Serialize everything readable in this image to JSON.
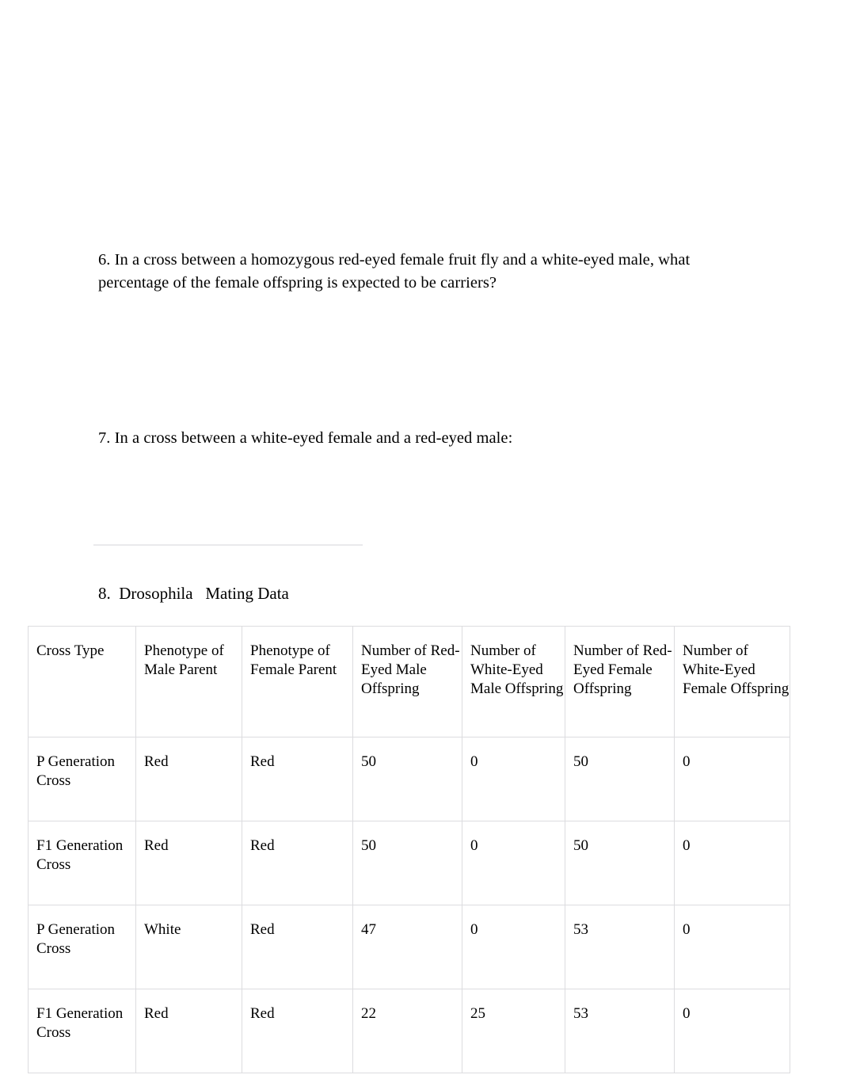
{
  "questions": [
    {
      "id": "q6",
      "text": "6. In a cross between a homozygous red-eyed female fruit fly and a white-eyed male, what percentage of the female offspring is expected to be carriers?"
    },
    {
      "id": "q7",
      "text": "7. In a cross between a white-eyed female and a red-eyed male:"
    }
  ],
  "table_section": {
    "caption": "8.  Drosophila   Mating Data",
    "headers": [
      "Cross Type",
      "Phenotype of Male Parent",
      "Phenotype of Female Parent",
      "Number of Red-Eyed Male Offspring",
      "Number of White-Eyed Male Offspring",
      "Number of Red-Eyed Female Offspring",
      "Number of White-Eyed Female Offspring"
    ],
    "rows": [
      {
        "cross_type": "P Generation Cross",
        "male_parent_phenotype": "Red",
        "female_parent_phenotype": "Red",
        "red_eyed_male_offspring": "50",
        "white_eyed_male_offspring": "0",
        "red_eyed_female_offspring": "50",
        "white_eyed_female_offspring": "0"
      },
      {
        "cross_type": "F1 Generation Cross",
        "male_parent_phenotype": "Red",
        "female_parent_phenotype": "Red",
        "red_eyed_male_offspring": "50",
        "white_eyed_male_offspring": "0",
        "red_eyed_female_offspring": "50",
        "white_eyed_female_offspring": "0"
      },
      {
        "cross_type": "P Generation Cross",
        "male_parent_phenotype": "White",
        "female_parent_phenotype": "Red",
        "red_eyed_male_offspring": "47",
        "white_eyed_male_offspring": "0",
        "red_eyed_female_offspring": "53",
        "white_eyed_female_offspring": "0"
      },
      {
        "cross_type": "F1 Generation Cross",
        "male_parent_phenotype": "Red",
        "female_parent_phenotype": "Red",
        "red_eyed_male_offspring": "22",
        "white_eyed_male_offspring": "25",
        "red_eyed_female_offspring": "53",
        "white_eyed_female_offspring": "0"
      }
    ]
  },
  "colors": {
    "page_background": "#ffffff",
    "text": "#000000",
    "table_border": "#dcdcdf",
    "faint_rule": "#e9e9ec"
  }
}
